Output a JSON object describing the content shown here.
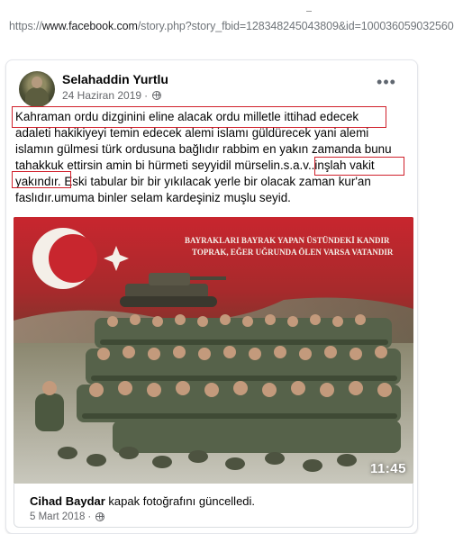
{
  "browser": {
    "url_prefix": "https://",
    "url_host": "www.facebook.com",
    "url_path": "/story.php?story_fbid=128348245043809&id=100036059032560"
  },
  "post": {
    "author": "Selahaddin Yurtlu",
    "date": "24 Haziran 2019",
    "more_label": "•••",
    "text_lines": [
      "Kahraman ordu dizginini eline alacak ordu milletle ittihad edecek",
      "adaleti hakikiyeyi temin edecek alemi islamı güldürecek yani alemi",
      "islamın gülmesi türk ordusuna bağlıdır rabbim en yakın zamanda bunu",
      "tahakkuk ettirsin amin bi hürmeti seyyidil mürselin.s.a.v..inşlah vakit",
      "yakındır.  Eski tabular bir bir yıkılacak yerle bir olacak zaman kur'an",
      "faslıdır.umuma binler selam kardeşiniz muşlu seyid."
    ],
    "highlight_color": "#d0202b"
  },
  "media": {
    "banner_line_1": "BAYRAKLARI BAYRAK YAPAN ÜSTÜNDEKİ KANDIR",
    "banner_line_2": "TOPRAK, EĞER UĞRUNDA ÖLEN VARSA VATANDIR",
    "duration": "11:45",
    "flag_color": "#d7202c"
  },
  "shared": {
    "user": "Cihad Baydar",
    "action": " kapak fotoğrafını güncelledi.",
    "date": "5 Mart 2018"
  }
}
